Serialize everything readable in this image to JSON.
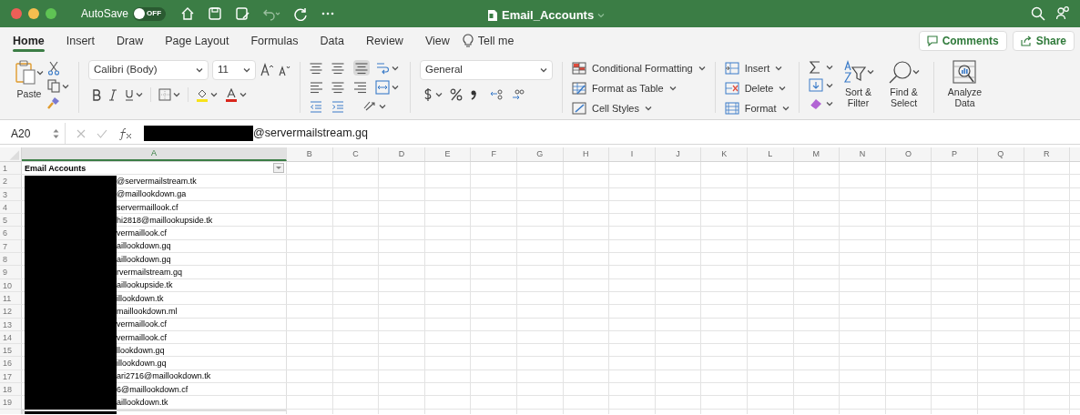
{
  "title_bar": {
    "autosave_label": "AutoSave",
    "autosave_toggle": {
      "label": "OFF",
      "on": false
    },
    "title": "Email_Accounts"
  },
  "tabs": [
    {
      "label": "Home",
      "selected": true
    },
    {
      "label": "Insert",
      "selected": false
    },
    {
      "label": "Draw",
      "selected": false
    },
    {
      "label": "Page Layout",
      "selected": false
    },
    {
      "label": "Formulas",
      "selected": false
    },
    {
      "label": "Data",
      "selected": false
    },
    {
      "label": "Review",
      "selected": false
    },
    {
      "label": "View",
      "selected": false
    }
  ],
  "tell_me": "Tell me",
  "comments_button": "Comments",
  "share_button": "Share",
  "ribbon": {
    "paste": "Paste",
    "font_name": "Calibri (Body)",
    "font_size": "11",
    "number_format": "General",
    "styles": [
      "Conditional Formatting",
      "Format as Table",
      "Cell Styles"
    ],
    "cells": [
      "Insert",
      "Delete",
      "Format"
    ],
    "sort_filter": "Sort & Filter",
    "find_select": "Find & Select",
    "analyze_data": "Analyze Data"
  },
  "formula_bar": {
    "cell_ref": "A20",
    "value": "@servermailstream.gq"
  },
  "columns": [
    {
      "label": "A",
      "selected": true
    },
    {
      "label": "B",
      "selected": false
    },
    {
      "label": "C",
      "selected": false
    },
    {
      "label": "D",
      "selected": false
    },
    {
      "label": "E",
      "selected": false
    },
    {
      "label": "F",
      "selected": false
    },
    {
      "label": "G",
      "selected": false
    },
    {
      "label": "H",
      "selected": false
    },
    {
      "label": "I",
      "selected": false
    },
    {
      "label": "J",
      "selected": false
    },
    {
      "label": "K",
      "selected": false
    },
    {
      "label": "L",
      "selected": false
    },
    {
      "label": "M",
      "selected": false
    },
    {
      "label": "N",
      "selected": false
    },
    {
      "label": "O",
      "selected": false
    },
    {
      "label": "P",
      "selected": false
    },
    {
      "label": "Q",
      "selected": false
    },
    {
      "label": "R",
      "selected": false
    }
  ],
  "rows": [
    {
      "number": "1",
      "kind": "header",
      "text": "Email Accounts"
    },
    {
      "number": "2",
      "kind": "entry",
      "text": "@servermailstream.tk"
    },
    {
      "number": "3",
      "kind": "entry",
      "text": "@maillookdown.ga"
    },
    {
      "number": "4",
      "kind": "entry",
      "text": "servermaillook.cf"
    },
    {
      "number": "5",
      "kind": "entry",
      "text": "hi2818@maillookupside.tk"
    },
    {
      "number": "6",
      "kind": "entry",
      "text": "vermaillook.cf"
    },
    {
      "number": "7",
      "kind": "entry",
      "text": "aillookdown.gq"
    },
    {
      "number": "8",
      "kind": "entry",
      "text": "aillookdown.gq"
    },
    {
      "number": "9",
      "kind": "entry",
      "text": "rvermailstream.gq"
    },
    {
      "number": "10",
      "kind": "entry",
      "text": "aillookupside.tk"
    },
    {
      "number": "11",
      "kind": "entry",
      "text": "illookdown.tk"
    },
    {
      "number": "12",
      "kind": "entry",
      "text": "maillookdown.ml"
    },
    {
      "number": "13",
      "kind": "entry",
      "text": "vermaillook.cf"
    },
    {
      "number": "14",
      "kind": "entry",
      "text": "vermaillook.cf"
    },
    {
      "number": "15",
      "kind": "entry",
      "text": "llookdown.gq"
    },
    {
      "number": "16",
      "kind": "entry",
      "text": "illookdown.gq"
    },
    {
      "number": "17",
      "kind": "entry",
      "text": "ari2716@maillookdown.tk"
    },
    {
      "number": "18",
      "kind": "entry",
      "text": "6@maillookdown.cf"
    },
    {
      "number": "19",
      "kind": "entry",
      "text": "aillookdown.tk"
    }
  ]
}
